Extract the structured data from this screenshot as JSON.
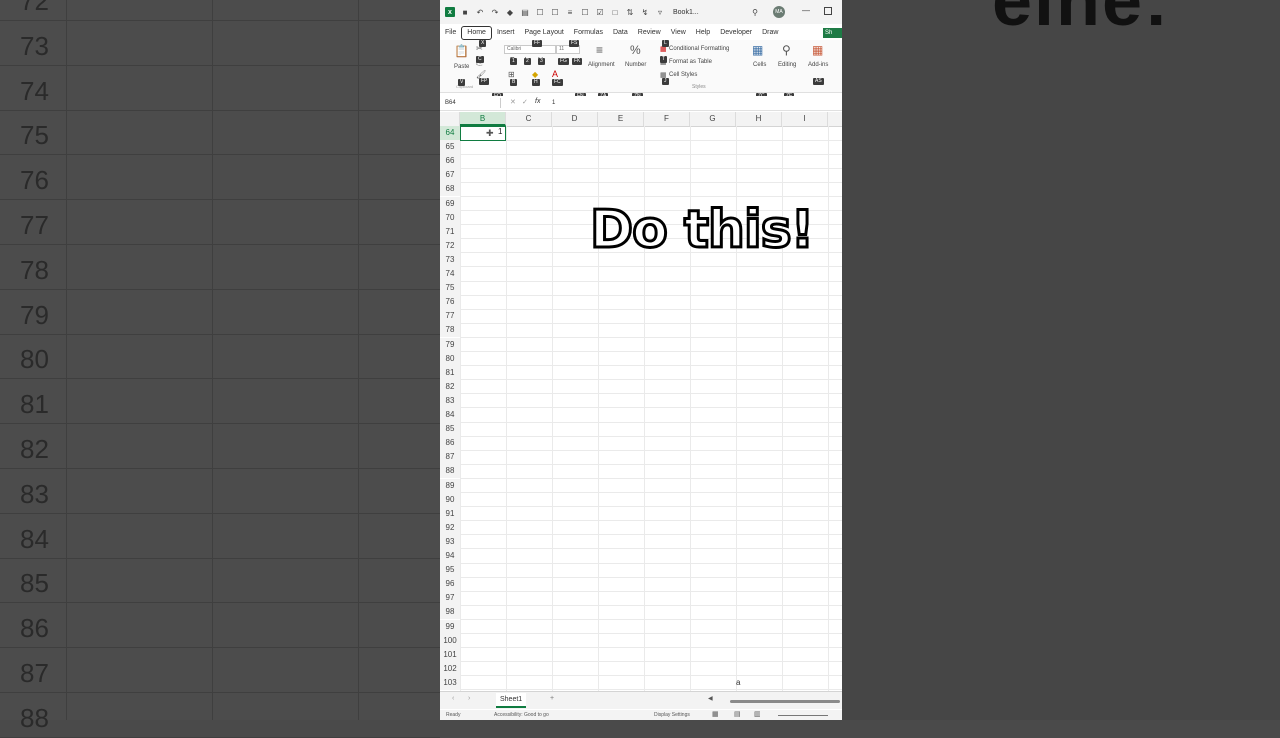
{
  "background": {
    "row_numbers": [
      "72",
      "73",
      "74",
      "75",
      "76",
      "77",
      "78",
      "79",
      "80",
      "81",
      "82",
      "83",
      "84",
      "85",
      "86",
      "87",
      "88"
    ],
    "big_text": "eine:"
  },
  "titlebar": {
    "book_title": "Book1...",
    "avatar_initials": "MA",
    "minimize": "—"
  },
  "tabs": [
    "File",
    "Home",
    "Insert",
    "Page Layout",
    "Formulas",
    "Data",
    "Review",
    "View",
    "Help",
    "Developer",
    "Draw"
  ],
  "share_label": "Sh",
  "ribbon": {
    "paste_label": "Paste",
    "font_name": "Calibri",
    "font_size": "11",
    "alignment_label": "Alignment",
    "number_label": "Number",
    "conditional_formatting": "Conditional Formatting",
    "format_as_table": "Format as Table",
    "cell_styles": "Cell Styles",
    "styles_group": "Styles",
    "cells_label": "Cells",
    "editing_label": "Editing",
    "addins_label": "Add-ins",
    "clipboard_group": "Clipboard",
    "addins_group": "Add-ins",
    "keytips": [
      "X",
      "FF",
      "FS",
      "C",
      "FP",
      "1",
      "2",
      "3",
      "FG",
      "FK",
      "V",
      "FO",
      "B",
      "H",
      "FC",
      "FN",
      "ZA",
      "ZN",
      "L",
      "T",
      "J",
      "ZC",
      "ZE",
      "AS"
    ]
  },
  "formula_bar": {
    "name_box": "B64",
    "fx": "fx",
    "value": "1"
  },
  "columns": [
    "B",
    "C",
    "D",
    "E",
    "F",
    "G",
    "H",
    "I"
  ],
  "selected_column": "B",
  "rows": [
    "64",
    "65",
    "66",
    "67",
    "68",
    "69",
    "70",
    "71",
    "72",
    "73",
    "74",
    "75",
    "76",
    "77",
    "78",
    "79",
    "80",
    "81",
    "82",
    "83",
    "84",
    "85",
    "86",
    "87",
    "88",
    "89",
    "90",
    "91",
    "92",
    "93",
    "94",
    "95",
    "96",
    "97",
    "98",
    "99",
    "100",
    "101",
    "102",
    "103"
  ],
  "active_cell_value": "1",
  "overlay_text": "Do this!",
  "sheet_tabs": [
    "Sheet1"
  ],
  "status": {
    "ready": "Ready",
    "accessibility": "Accessibility: Good to go",
    "display_settings": "Display Settings",
    "scroll_char": "a"
  },
  "colors": {
    "accent": "#107c41",
    "ribbon_bg": "#fafafa"
  }
}
